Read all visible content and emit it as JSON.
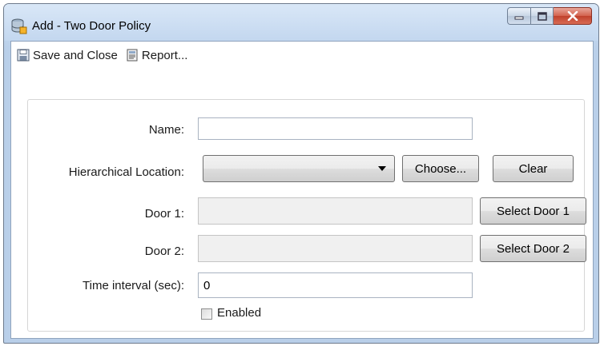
{
  "window": {
    "title": "Add - Two Door Policy",
    "icons": {
      "app": "database-icon",
      "minimize": "minimize-icon",
      "maximize": "maximize-icon",
      "close": "close-icon"
    }
  },
  "toolbar": {
    "save_label": "Save and Close",
    "save_icon": "floppy-disk-icon",
    "report_label": "Report...",
    "report_icon": "report-icon"
  },
  "form": {
    "name_label": "Name:",
    "name_value": "",
    "location_label": "Hierarchical Location:",
    "location_value": "",
    "choose_label": "Choose...",
    "clear_label": "Clear",
    "door1_label": "Door 1:",
    "door1_value": "",
    "select_door1_label": "Select Door 1",
    "door2_label": "Door 2:",
    "door2_value": "",
    "select_door2_label": "Select Door 2",
    "interval_label": "Time interval (sec):",
    "interval_value": "0",
    "enabled_label": "Enabled",
    "enabled_checked": false
  },
  "colors": {
    "titlebar": "#c3d7ef",
    "close_button": "#c0412c"
  }
}
